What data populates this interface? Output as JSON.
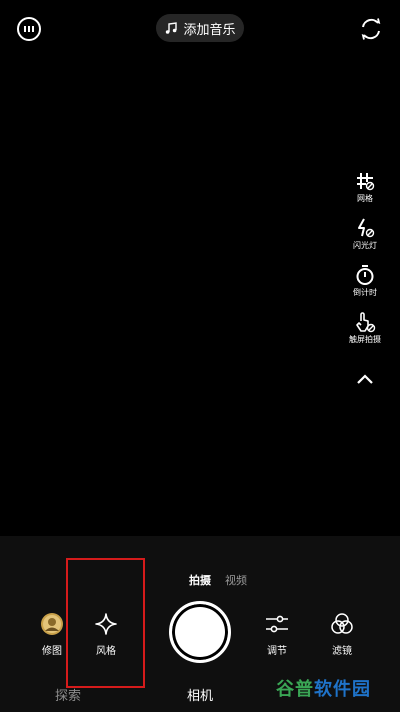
{
  "top_bar": {
    "menu_icon": "ellipsis-circle-icon",
    "music_label": "添加音乐",
    "switch_icon": "camera-switch-icon"
  },
  "side_tools": [
    {
      "label": "网格",
      "icon": "grid-icon"
    },
    {
      "label": "闪光灯",
      "icon": "flash-off-icon"
    },
    {
      "label": "倒计时",
      "icon": "timer-icon"
    },
    {
      "label": "触屏拍摄",
      "icon": "touch-shoot-icon"
    }
  ],
  "collapse_icon": "chevron-up-icon",
  "modes": {
    "photo": "拍摄",
    "video": "视频"
  },
  "controls": {
    "edit": "修图",
    "style": "风格",
    "adjust": "调节",
    "filter": "滤镜"
  },
  "bottom_tabs": {
    "explore": "探索",
    "camera": "相机"
  },
  "watermark": {
    "part1": "谷普",
    "part2": "软件园"
  },
  "colors": {
    "highlight": "#d51b1b",
    "watermark_green": "#3aa655",
    "watermark_blue": "#1f73c9"
  }
}
